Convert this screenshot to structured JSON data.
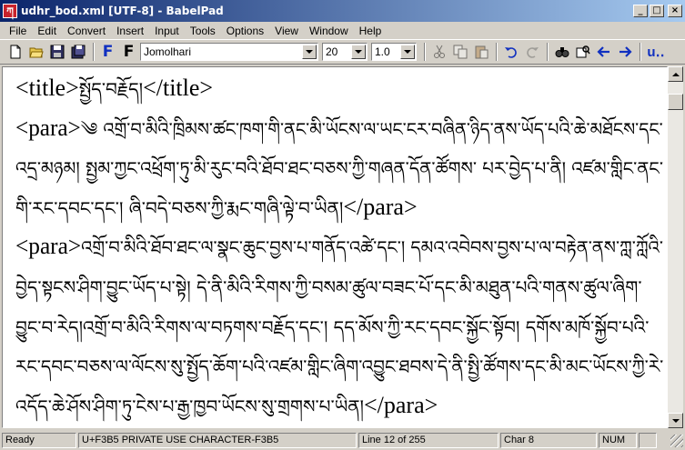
{
  "window": {
    "title": "udhr_bod.xml [UTF-8] - BabelPad",
    "app_icon_glyph": "ཀ",
    "buttons": {
      "minimize": "_",
      "maximize": "□",
      "close": "×"
    }
  },
  "menu": [
    "File",
    "Edit",
    "Convert",
    "Insert",
    "Input",
    "Tools",
    "Options",
    "View",
    "Window",
    "Help"
  ],
  "toolbar": {
    "icons": [
      "new-document-icon",
      "open-folder-icon",
      "save-icon",
      "save-all-icon",
      "font-f-blue-icon",
      "font-f-black-icon"
    ],
    "font_letter": "F",
    "font_name": "Jomolhari",
    "font_size": "20",
    "line_spacing": "1.0",
    "edit_icons": [
      "cut-icon",
      "copy-icon",
      "paste-icon",
      "undo-icon",
      "redo-icon"
    ],
    "other_icons": [
      "find-icon",
      "replace-icon",
      "back-arrow-icon",
      "forward-arrow-icon",
      "unicode-icon"
    ],
    "unicode_label": "u‥"
  },
  "editor": {
    "lines": [
      {
        "parts": [
          {
            "t": "<title>",
            "c": "lat"
          },
          {
            "t": "སྤྱོད་བརྗོད།",
            "c": "tib"
          },
          {
            "t": "</title>",
            "c": "lat"
          }
        ]
      },
      {
        "parts": [
          {
            "t": "<para>",
            "c": "lat"
          },
          {
            "t": "༄ འགྲོ་བ་མིའི་ཁྲིམས་ཚང་ཁག་གི་ནང་མི་ཡོངས་ལ་ཡང་ངར་བཞིན་ཉིད་ནས་ཡོད་པའི་ཆེ་མཐོངས་དང་",
            "c": "tib"
          }
        ]
      },
      {
        "parts": [
          {
            "t": "འདྲ་མཉམ། སྤྱམ་ཀྱང་འཕྲོག་ཏུ་མི་རུང་བའི་ཐོབ་ཐང་བཅས་ཀྱི་གཞན་དོན་ཚོགས་ པར་བྱེད་པ་ནི། འཛམ་གླིང་ནང་",
            "c": "tib"
          }
        ]
      },
      {
        "parts": [
          {
            "t": "གི་རང་དབང་དང་། ཞི་བདེ་བཅས་ཀྱི་རྨང་གཞི་ལྟེ་བ་ཡིན།",
            "c": "tib"
          },
          {
            "t": "</para>",
            "c": "lat"
          }
        ]
      },
      {
        "parts": [
          {
            "t": "<para>",
            "c": "lat"
          },
          {
            "t": "འགྲོ་བ་མིའི་ཐོབ་ཐང་ལ་སྣང་ཆུང་བྱས་པ་གནོད་འཚེ་དང་། དམའ་འབེབས་བྱས་པ་ལ་བརྟེན་ནས་ཀླ་ཀློའི་",
            "c": "tib"
          }
        ]
      },
      {
        "parts": [
          {
            "t": "བྱེད་སྟངས་ཤིག་བྱུང་ཡོད་པ་སྟེ། དེ་ནི་མིའི་རིགས་ཀྱི་བསམ་ཚུལ་བཟང་པོ་དང་མི་མཐུན་པའི་གནས་ཚུལ་ཞིག་",
            "c": "tib"
          }
        ]
      },
      {
        "parts": [
          {
            "t": "བྱུང་བ་རེད།འགྲོ་བ་མིའི་རིགས་ལ་བཏགས་བརྗོད་དང་། དད་མོས་ཀྱི་རང་དབང་སྐྱོང་སྟོབ། དགོས་མཁོ་སྐྱོབ་པའི་",
            "c": "tib"
          }
        ]
      },
      {
        "parts": [
          {
            "t": "རང་དབང་བཅས་ལ་ལོངས་སུ་སྤྱོད་ཆོག་པའི་འཛམ་གླིང་ཞིག་འབྱུང་ཐབས་དེ་ནི་སྤྱི་ཚོགས་དང་མི་མང་ཡོངས་ཀྱི་རེ་",
            "c": "tib"
          }
        ]
      },
      {
        "parts": [
          {
            "t": "འདོད་ཆེ་ཤོས་ཤིག་ཏུ་ངེས་པ་རྒྱ་ཁྱབ་ཡོངས་སུ་གྲགས་པ་ཡིན།",
            "c": "tib"
          },
          {
            "t": "</para>",
            "c": "lat"
          }
        ]
      }
    ]
  },
  "status": {
    "ready": "Ready",
    "char_info": "U+F3B5 PRIVATE USE CHARACTER-F3B5",
    "line": "Line 12 of 255",
    "char": "Char 8",
    "num": "NUM"
  }
}
